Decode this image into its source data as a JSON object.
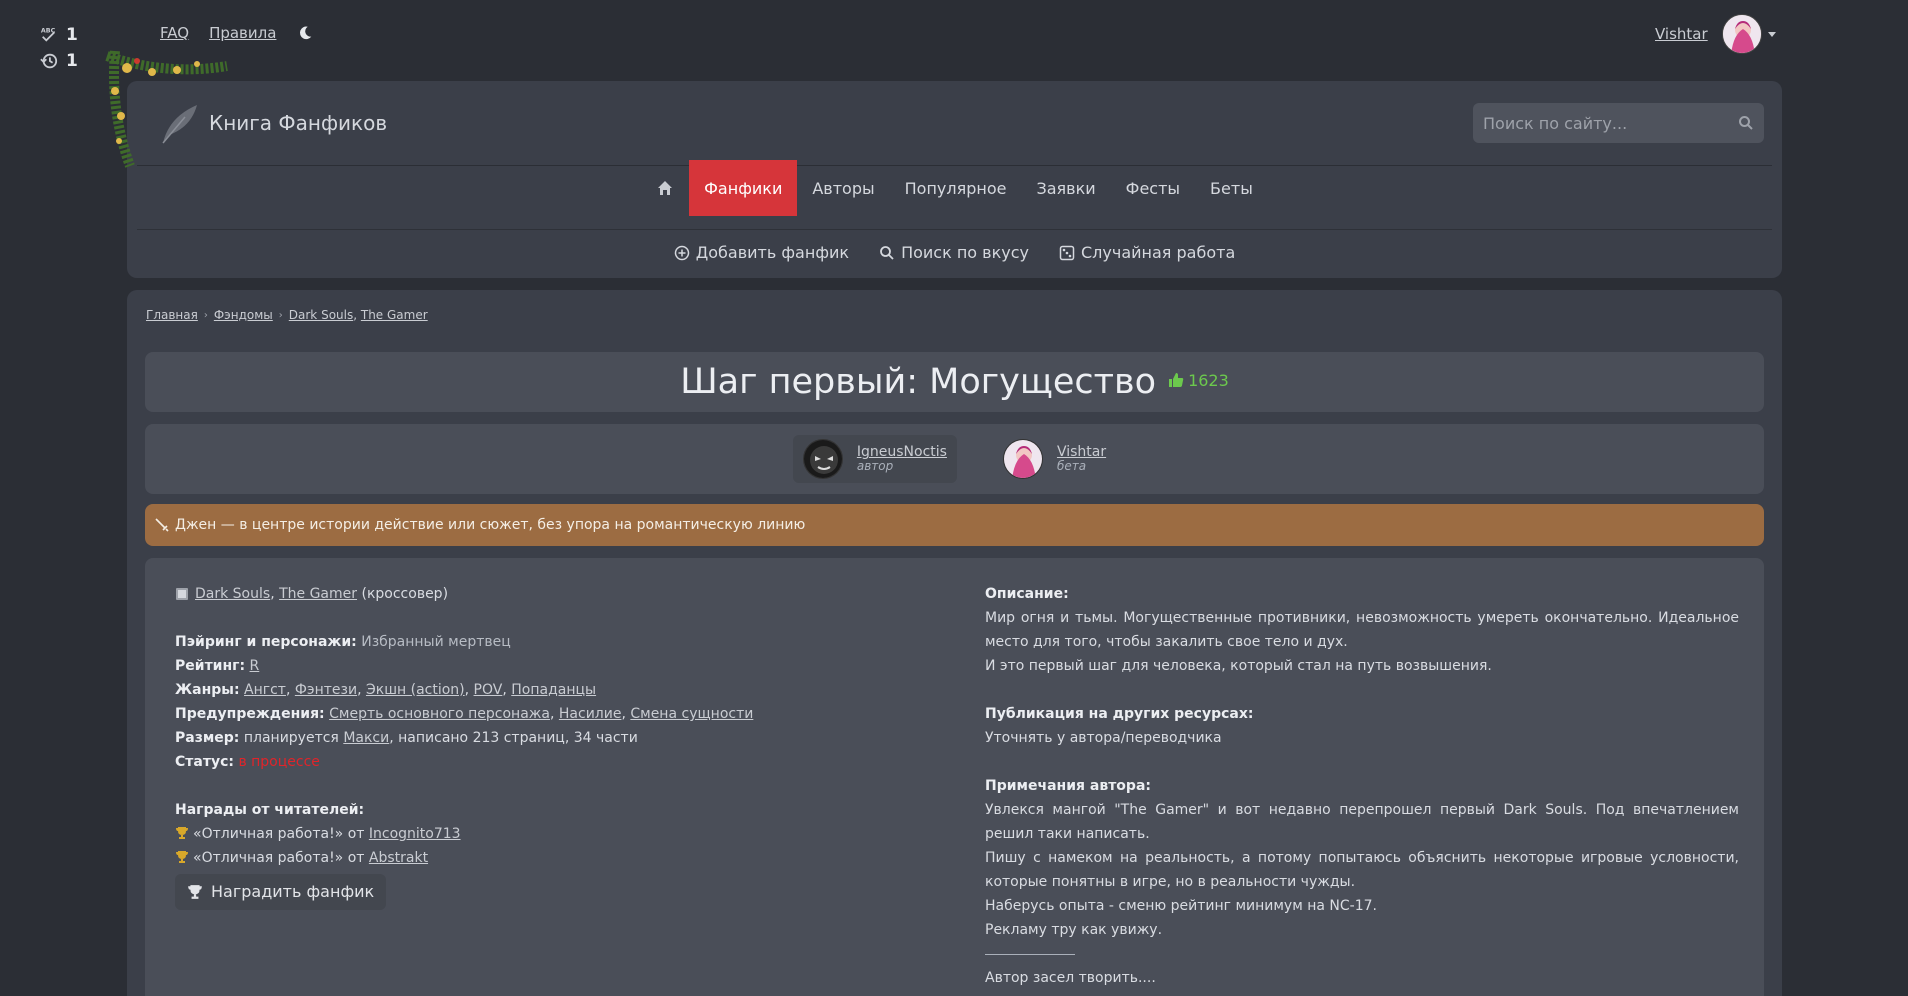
{
  "counters": [
    {
      "icon": "spellcheck-icon",
      "value": "1"
    },
    {
      "icon": "history-icon",
      "value": "1"
    }
  ],
  "toplinks": {
    "faq": "FAQ",
    "rules": "Правила"
  },
  "user": {
    "name": "Vishtar"
  },
  "header": {
    "logo_text": "Книга Фанфиков",
    "search_placeholder": "Поиск по сайту...",
    "nav": [
      "Фанфики",
      "Авторы",
      "Популярное",
      "Заявки",
      "Фесты",
      "Беты"
    ],
    "subnav": [
      "Добавить фанфик",
      "Поиск по вкусу",
      "Случайная работа"
    ]
  },
  "breadcrumbs": [
    "Главная",
    "Фэндомы",
    "Dark Souls",
    "The Gamer"
  ],
  "fanfic": {
    "title": "Шаг первый: Могущество",
    "likes": "1623",
    "authors": [
      {
        "name": "IgneusNoctis",
        "role": "автор"
      },
      {
        "name": "Vishtar",
        "role": "бета"
      }
    ],
    "direction": "Джен — в центре истории действие или сюжет, без упора на романтическую линию",
    "fandoms": [
      "Dark Souls",
      "The Gamer"
    ],
    "fandom_suffix": "(кроссовер)",
    "pairing_label": "Пэйринг и персонажи:",
    "pairing": "Избранный мертвец",
    "rating_label": "Рейтинг:",
    "rating": "R",
    "genres_label": "Жанры:",
    "genres": [
      "Ангст",
      "Фэнтези",
      "Экшн (action)",
      "POV",
      "Попаданцы"
    ],
    "warnings_label": "Предупреждения:",
    "warnings": [
      "Смерть основного персонажа",
      "Насилие",
      "Смена сущности"
    ],
    "size_label": "Размер:",
    "size_prefix": "планируется",
    "size_link": "Макси",
    "size_suffix": ", написано 213 страниц, 34 части",
    "status_label": "Статус:",
    "status": "в процессе",
    "awards_label": "Награды от читателей:",
    "awards": [
      {
        "text": "«Отличная работа!» от",
        "user": "Incognito713"
      },
      {
        "text": "«Отличная работа!» от",
        "user": "Abstrakt"
      }
    ],
    "award_button": "Наградить фанфик",
    "description_label": "Описание:",
    "description": [
      "Мир огня и тьмы. Могущественные противники, невозможность умереть окончательно. Идеальное место для того, чтобы закалить свое тело и дух.",
      "И это первый шаг для человека, который стал на путь возвышения."
    ],
    "publication_label": "Публикация на других ресурсах:",
    "publication": "Уточнять у автора/переводчика",
    "notes_label": "Примечания автора:",
    "notes": [
      "Увлекся мангой \"The Gamer\" и вот недавно перепрошел первый Dark Souls. Под впечатлением решил таки написать.",
      "Пишу с намеком на реальность, а потому попытаюсь объяснить некоторые игровые условности, которые понятны в игре, но в реальности чужды.",
      "Наберусь опыта - сменю рейтинг минимум на NC-17.",
      "Рекламу тру как увижу."
    ],
    "notes_after": "Автор засел творить...."
  },
  "colors": {
    "accent": "#d6353a",
    "direction_bg": "#9c6c42",
    "likes": "#6cc94d",
    "status": "#e0242a"
  }
}
